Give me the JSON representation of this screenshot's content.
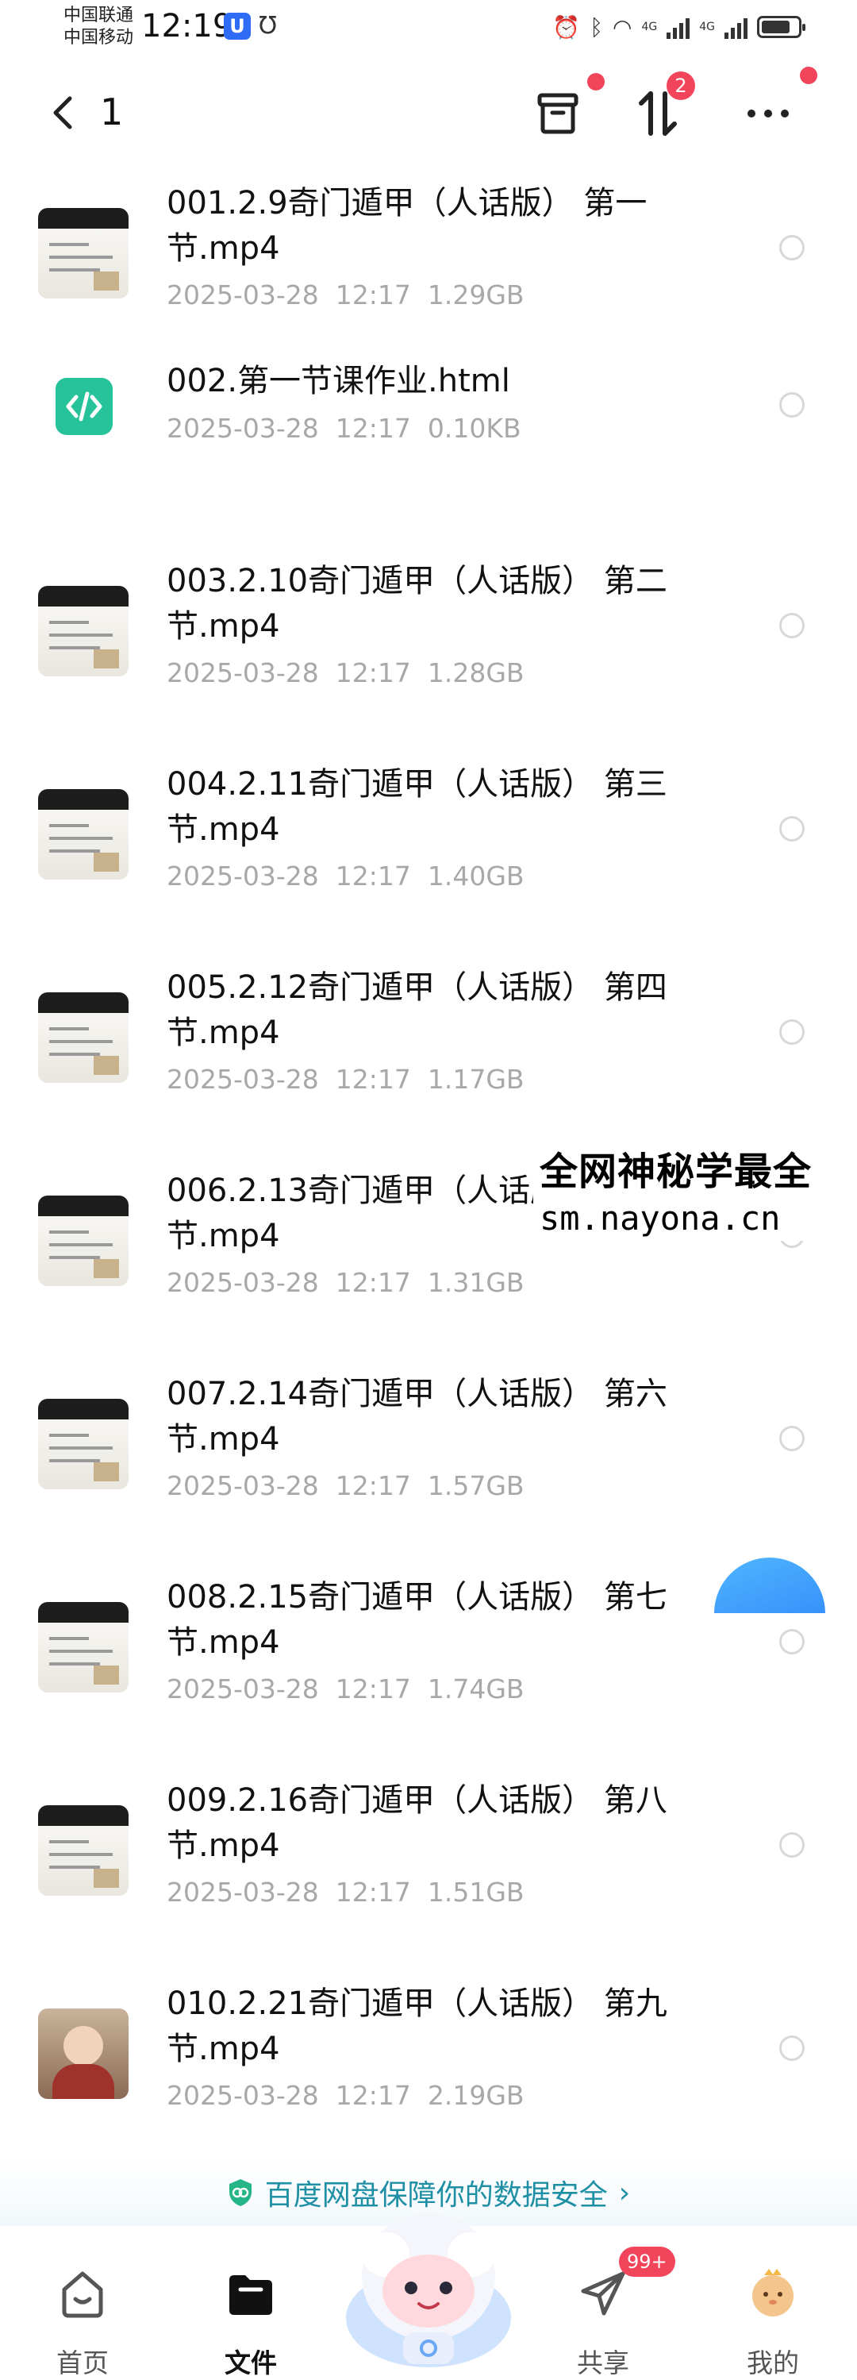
{
  "status_bar": {
    "carrier_1": "中国联通",
    "carrier_2": "中国移动",
    "time": "12:19",
    "net_1": "4G",
    "net_2": "4G",
    "battery_level": 0.8
  },
  "nav": {
    "title": "1",
    "sort_badge": "2"
  },
  "files": [
    {
      "name": "001.2.9奇门遁甲（人话版） 第一节.mp4",
      "date": "2025-03-28",
      "time": "12:17",
      "size": "1.29GB",
      "type": "video"
    },
    {
      "name": "002.第一节课作业.html",
      "date": "2025-03-28",
      "time": "12:17",
      "size": "0.10KB",
      "type": "html"
    },
    {
      "name": "003.2.10奇门遁甲（人话版） 第二节.mp4",
      "date": "2025-03-28",
      "time": "12:17",
      "size": "1.28GB",
      "type": "video"
    },
    {
      "name": "004.2.11奇门遁甲（人话版） 第三节.mp4",
      "date": "2025-03-28",
      "time": "12:17",
      "size": "1.40GB",
      "type": "video"
    },
    {
      "name": "005.2.12奇门遁甲（人话版） 第四节.mp4",
      "date": "2025-03-28",
      "time": "12:17",
      "size": "1.17GB",
      "type": "video"
    },
    {
      "name": "006.2.13奇门遁甲（人话版） 第五节.mp4",
      "date": "2025-03-28",
      "time": "12:17",
      "size": "1.31GB",
      "type": "video"
    },
    {
      "name": "007.2.14奇门遁甲（人话版） 第六节.mp4",
      "date": "2025-03-28",
      "time": "12:17",
      "size": "1.57GB",
      "type": "video"
    },
    {
      "name": "008.2.15奇门遁甲（人话版） 第七节.mp4",
      "date": "2025-03-28",
      "time": "12:17",
      "size": "1.74GB",
      "type": "video"
    },
    {
      "name": "009.2.16奇门遁甲（人话版） 第八节.mp4",
      "date": "2025-03-28",
      "time": "12:17",
      "size": "1.51GB",
      "type": "video"
    },
    {
      "name": "010.2.21奇门遁甲（人话版） 第九节.mp4",
      "date": "2025-03-28",
      "time": "12:17",
      "size": "2.19GB",
      "type": "video"
    }
  ],
  "watermark": {
    "line1": "全网神秘学最全",
    "line2": "sm.nayona.cn"
  },
  "security_banner": {
    "text": "百度网盘保障你的数据安全",
    "chevron": "›"
  },
  "tabs": {
    "home": "首页",
    "files": "文件",
    "share": "共享",
    "share_badge": "99+",
    "mine": "我的"
  },
  "colors": {
    "accent_teal": "#1f8fa5",
    "badge_red": "#f2445a",
    "html_icon": "#26c29a",
    "fab_blue": "#2a7cf7"
  }
}
